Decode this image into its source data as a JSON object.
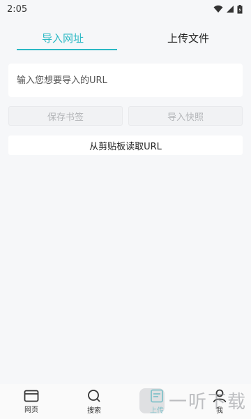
{
  "status": {
    "time": "2:05"
  },
  "tabs": [
    {
      "label": "导入网址",
      "active": true
    },
    {
      "label": "上传文件",
      "active": false
    }
  ],
  "url_input": {
    "placeholder": "输入您想要导入的URL",
    "value": ""
  },
  "buttons": {
    "save_bookmark": "保存书签",
    "import_snapshot": "导入快照",
    "read_clipboard": "从剪贴板读取URL"
  },
  "bottom_nav": [
    {
      "label": "网页",
      "icon": "browser-icon"
    },
    {
      "label": "搜索",
      "icon": "search-icon"
    },
    {
      "label": "上传",
      "icon": "upload-icon",
      "active": true
    },
    {
      "label": "我",
      "icon": "person-icon"
    }
  ],
  "watermark": {
    "text": "一听下载"
  },
  "colors": {
    "accent": "#2bb8c4",
    "background": "#f6f7f9"
  }
}
